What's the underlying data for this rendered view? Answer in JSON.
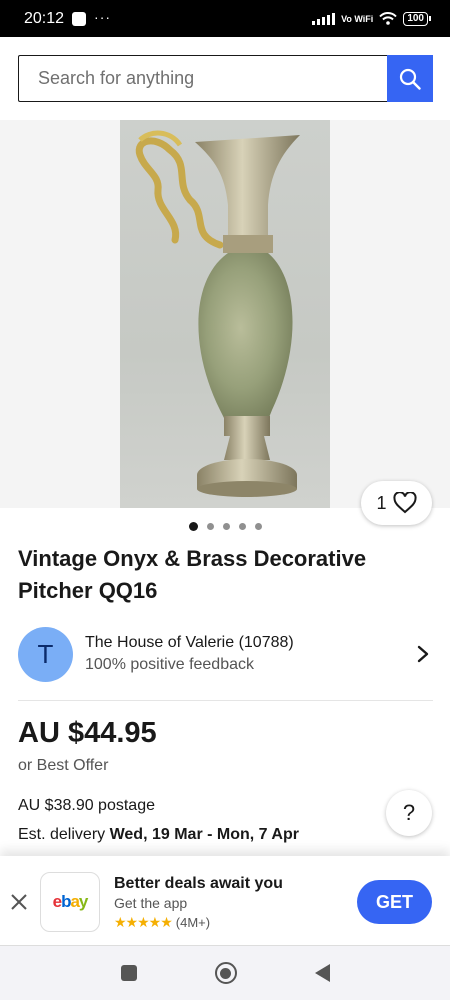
{
  "status_bar": {
    "time": "20:12",
    "more": "···",
    "network": "Vo WiFi",
    "battery": "100"
  },
  "search": {
    "placeholder": "Search for anything",
    "value": ""
  },
  "listing": {
    "image_count": 5,
    "active_image": 1,
    "watch_count": "1",
    "title": "Vintage Onyx & Brass Decorative Pitcher QQ16",
    "seller": {
      "initial": "T",
      "name": "The House of Valerie (10788)",
      "feedback": "100% positive feedback"
    },
    "price": "AU $44.95",
    "best_offer": "or Best Offer",
    "postage": "AU $38.90 postage",
    "delivery_prefix": "Est. delivery ",
    "delivery_dates": "Wed, 19 Mar - Mon, 7 Apr",
    "help_label": "?"
  },
  "app_banner": {
    "app_name": "ebay",
    "title": "Better deals await you",
    "subtitle": "Get the app",
    "stars": "★★★★★",
    "rating_count": "(4M+)",
    "get_label": "GET"
  },
  "colors": {
    "accent": "#3665f3",
    "avatar": "#7aaef6",
    "star": "#f5af02"
  }
}
